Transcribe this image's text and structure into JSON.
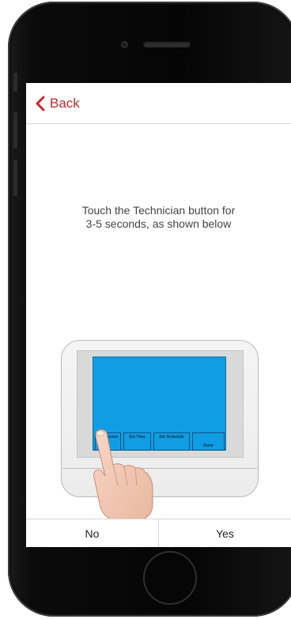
{
  "nav": {
    "back_label": "Back",
    "back_icon": "chevron-left-icon"
  },
  "instruction": {
    "line1": "Touch the Technician button for",
    "line2": "3-5 seconds, as shown below"
  },
  "thermostat": {
    "buttons": [
      {
        "label": "Technician"
      },
      {
        "label": "Set Time"
      },
      {
        "label": "Set Schedule"
      },
      {
        "label": "Done"
      }
    ]
  },
  "choices": {
    "no_label": "No",
    "yes_label": "Yes"
  },
  "colors": {
    "accent": "#d8232a",
    "lcd": "#0f9de3"
  }
}
